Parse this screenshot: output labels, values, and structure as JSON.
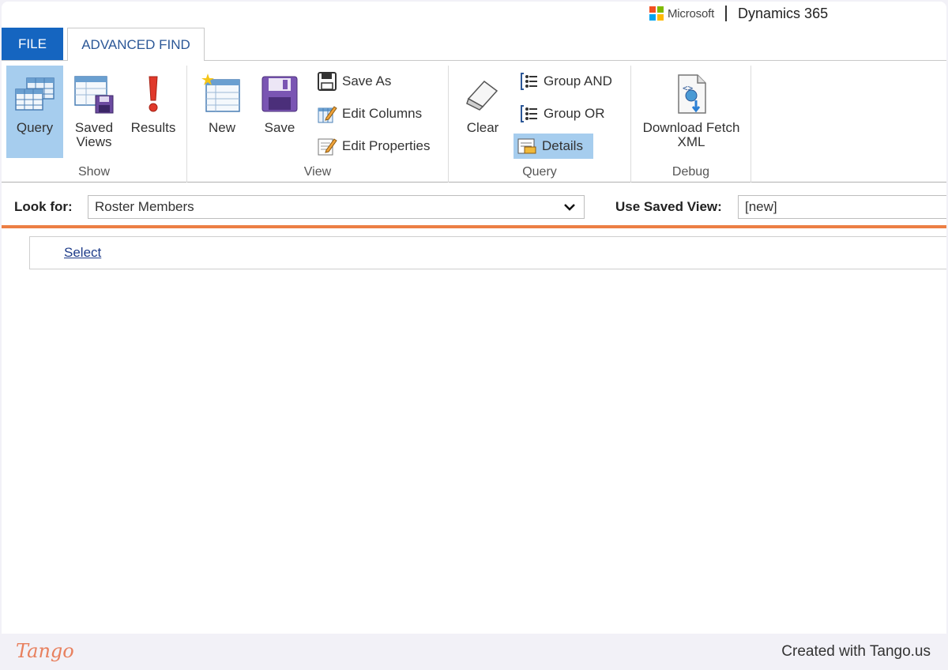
{
  "brand": {
    "company": "Microsoft",
    "product": "Dynamics 365",
    "logo_colors": [
      "#f25022",
      "#7fba00",
      "#00a4ef",
      "#ffb900"
    ]
  },
  "tabs": {
    "file": "FILE",
    "advanced_find": "ADVANCED FIND"
  },
  "ribbon": {
    "show": {
      "label": "Show",
      "query": "Query",
      "saved_views_line1": "Saved",
      "saved_views_line2": "Views",
      "results": "Results"
    },
    "view": {
      "label": "View",
      "new": "New",
      "save": "Save",
      "save_as": "Save As",
      "edit_columns": "Edit Columns",
      "edit_properties": "Edit Properties"
    },
    "query": {
      "label": "Query",
      "clear": "Clear",
      "group_and": "Group AND",
      "group_or": "Group OR",
      "details": "Details"
    },
    "debug": {
      "label": "Debug",
      "download_line1": "Download Fetch",
      "download_line2": "XML"
    }
  },
  "lookfor": {
    "label": "Look for:",
    "value": "Roster Members",
    "saved_view_label": "Use Saved View:",
    "saved_view_value": "[new]"
  },
  "criteria": {
    "select_link": "Select"
  },
  "footer": {
    "logo": "Tango",
    "credit": "Created with Tango.us"
  },
  "colors": {
    "file_tab": "#1565c0",
    "selected": "#a6cdee",
    "accent_rule": "#ec7f44",
    "link": "#1f3d8a"
  }
}
